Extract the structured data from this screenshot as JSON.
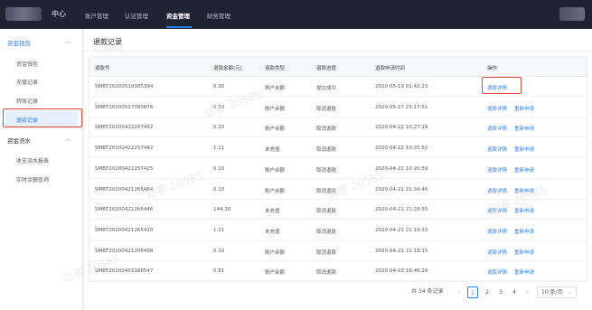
{
  "header": {
    "brand": "中心",
    "nav": [
      "账户管理",
      "认证管理",
      "资金管理",
      "财务管理"
    ],
    "active_nav": 2
  },
  "sidebar": {
    "groups": [
      {
        "label": "资金钱包",
        "expanded": true,
        "items": [
          "资金钱包",
          "充值记录",
          "转账记录",
          "退款记录"
        ]
      },
      {
        "label": "资金流水",
        "expanded": true,
        "items": [
          "收支流水报表",
          "实时余额查询"
        ]
      }
    ],
    "active_item": "退款记录"
  },
  "page": {
    "title": "退款记录"
  },
  "table": {
    "columns": [
      "退款号",
      "退款金额(元)",
      "退款类型",
      "退款进度",
      "退款申请时间",
      "操作"
    ],
    "rows": [
      [
        "SMBT20200519385394",
        "0.30",
        "账户余额",
        "提交成功",
        "2020-05-19 01:42:23",
        "退款详情",
        ""
      ],
      [
        "SMBT20200517380876",
        "0.30",
        "账户余额",
        "取消退款",
        "2020-05-17 23:17:51",
        "退款详情",
        "重新申请"
      ],
      [
        "SMBT20200422267452",
        "0.10",
        "账户余额",
        "取消退款",
        "2020-04-22 10:27:19",
        "退款详情",
        "重新申请"
      ],
      [
        "SMBT20200422257442",
        "1.11",
        "未充值",
        "取消退款",
        "2020-04-22 10:25:52",
        "退款详情",
        "重新申请"
      ],
      [
        "SMBT20200422257425",
        "0.10",
        "账户余额",
        "取消退款",
        "2020-04-22 10:20:59",
        "退款详情",
        "重新申请"
      ],
      [
        "SMBT20200421265464",
        "0.10",
        "账户余额",
        "取消退款",
        "2020-04-21 21:34:46",
        "退款详情",
        "重新申请"
      ],
      [
        "SMBT20200421265446",
        "144.30",
        "未充值",
        "取消退款",
        "2020-04-21 21:29:55",
        "退款详情",
        "重新申请"
      ],
      [
        "SMBT20200421265410",
        "1.11",
        "未充值",
        "取消退款",
        "2020-04-21 21:19:33",
        "退款详情",
        "重新申请"
      ],
      [
        "SMBT20200421265408",
        "0.10",
        "账户余额",
        "取消退款",
        "2020-04-21 21:18:15",
        "退款详情",
        "重新申请"
      ],
      [
        "SMBT20200403166547",
        "0.81",
        "账户余额",
        "取消退款",
        "2020-04-03 16:46:29",
        "退款详情",
        "重新申请"
      ]
    ]
  },
  "pagination": {
    "total_text": "共 34 条记录",
    "pages": [
      "1",
      "2",
      "3",
      "4"
    ],
    "current": "1",
    "prev": "‹",
    "next": "›",
    "page_size": "10 条/页"
  },
  "watermark": "访客 20585",
  "colors": {
    "accent": "#2d7df6",
    "topbar": "#1f2433",
    "highlight": "#e0443e"
  }
}
